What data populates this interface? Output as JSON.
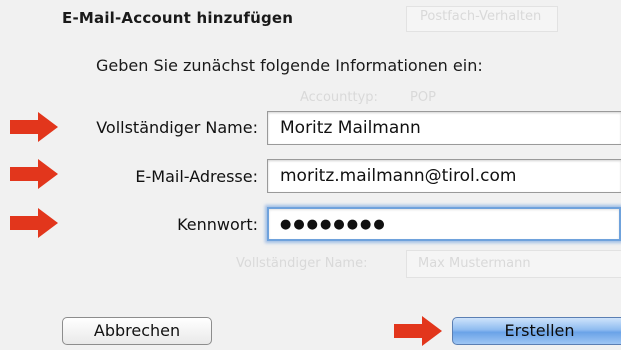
{
  "dialog": {
    "title": "E-Mail-Account hinzufügen",
    "intro": "Geben Sie zunächst folgende Informationen ein:"
  },
  "fields": {
    "full_name_label": "Vollständiger Name:",
    "full_name_value": "Moritz Mailmann",
    "email_label": "E-Mail-Adresse:",
    "email_value": "moritz.mailmann@tirol.com",
    "password_label": "Kennwort:",
    "password_mask": "●●●●●●●●"
  },
  "buttons": {
    "cancel": "Abbrechen",
    "create": "Erstellen"
  },
  "background_ghost": {
    "tab_label": "Postfach-Verhalten",
    "row1_label": "Accounttyp:",
    "row1_value": "POP",
    "row2_label": "Vollständiger Name:",
    "row2_value": "Max Mustermann"
  },
  "colors": {
    "arrow": "#e2361c",
    "focus_ring": "#6fa2dc",
    "default_button": "#6aa3e8"
  }
}
